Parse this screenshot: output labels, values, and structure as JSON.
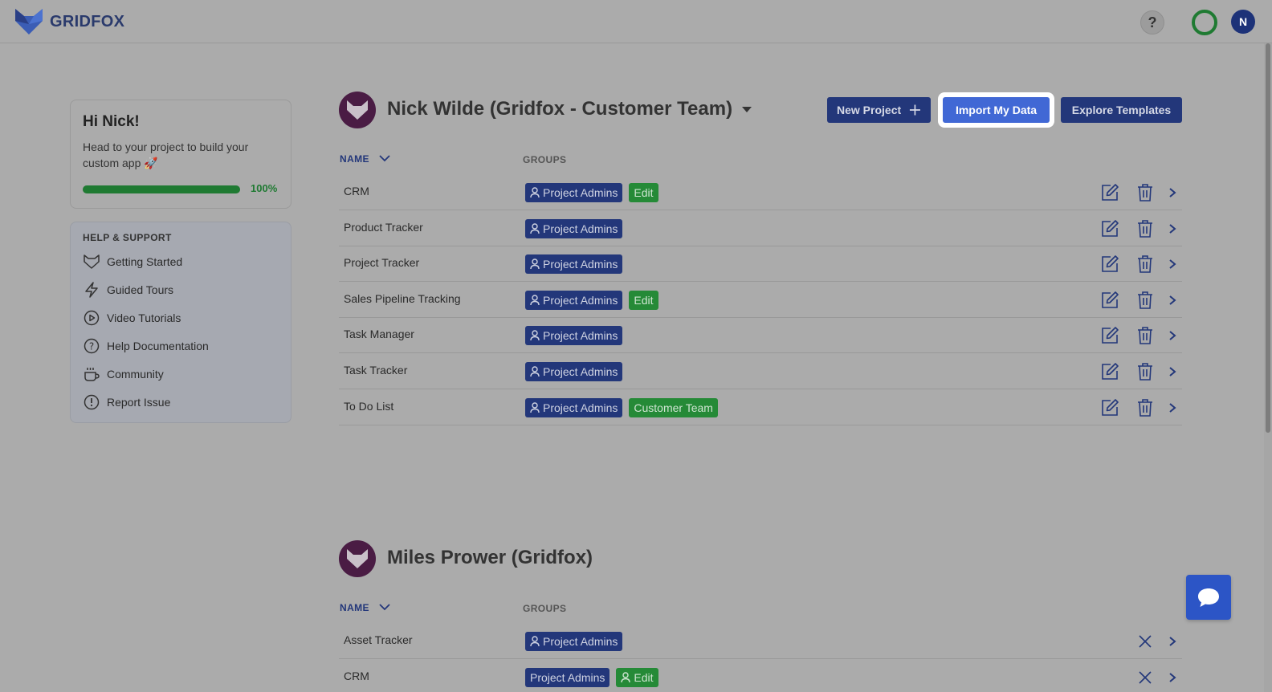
{
  "app": {
    "logo_text": "GRIDFOX",
    "help_label": "?",
    "avatar_initial": "N"
  },
  "welcome": {
    "title": "Hi Nick!",
    "subtitle": "Head to your project to build your custom app 🚀",
    "progress": 100,
    "progress_label": "100%"
  },
  "support": {
    "heading": "HELP & SUPPORT",
    "items": [
      {
        "label": "Getting Started",
        "icon": "fox-icon"
      },
      {
        "label": "Guided Tours",
        "icon": "lightning-icon"
      },
      {
        "label": "Video Tutorials",
        "icon": "play-circle-icon"
      },
      {
        "label": "Help Documentation",
        "icon": "question-circle-icon"
      },
      {
        "label": "Community",
        "icon": "coffee-cup-icon"
      },
      {
        "label": "Report Issue",
        "icon": "exclamation-circle-icon"
      }
    ]
  },
  "team1": {
    "name": "Nick Wilde (Gridfox - Customer Team)",
    "buttons": {
      "new_project": "New Project",
      "import": "Import My Data",
      "templates": "Explore Templates"
    },
    "col_name": "NAME",
    "col_groups": "GROUPS",
    "projects": [
      {
        "name": "CRM",
        "groups": [
          {
            "label": "Project Admins",
            "color": "blue",
            "icon": true
          },
          {
            "label": "Edit",
            "color": "green",
            "icon": false
          }
        ]
      },
      {
        "name": "Product Tracker",
        "groups": [
          {
            "label": "Project Admins",
            "color": "blue",
            "icon": true
          }
        ]
      },
      {
        "name": "Project Tracker",
        "groups": [
          {
            "label": "Project Admins",
            "color": "blue",
            "icon": true
          }
        ]
      },
      {
        "name": "Sales Pipeline Tracking",
        "groups": [
          {
            "label": "Project Admins",
            "color": "blue",
            "icon": true
          },
          {
            "label": "Edit",
            "color": "green",
            "icon": false
          }
        ]
      },
      {
        "name": "Task Manager",
        "groups": [
          {
            "label": "Project Admins",
            "color": "blue",
            "icon": true
          }
        ]
      },
      {
        "name": "Task Tracker",
        "groups": [
          {
            "label": "Project Admins",
            "color": "blue",
            "icon": true
          }
        ]
      },
      {
        "name": "To Do List",
        "groups": [
          {
            "label": "Project Admins",
            "color": "blue",
            "icon": true
          },
          {
            "label": "Customer Team",
            "color": "green",
            "icon": false
          }
        ]
      }
    ]
  },
  "team2": {
    "name": "Miles Prower (Gridfox)",
    "col_name": "NAME",
    "col_groups": "GROUPS",
    "projects": [
      {
        "name": "Asset Tracker",
        "groups": [
          {
            "label": "Project Admins",
            "color": "blue",
            "icon": true
          }
        ]
      },
      {
        "name": "CRM",
        "groups": [
          {
            "label": "Project Admins",
            "color": "blue",
            "icon": false
          },
          {
            "label": "Edit",
            "color": "green",
            "icon": true
          }
        ]
      }
    ]
  },
  "colors": {
    "brand": "#23377a",
    "accent": "#4168d5",
    "success": "#258a37"
  }
}
